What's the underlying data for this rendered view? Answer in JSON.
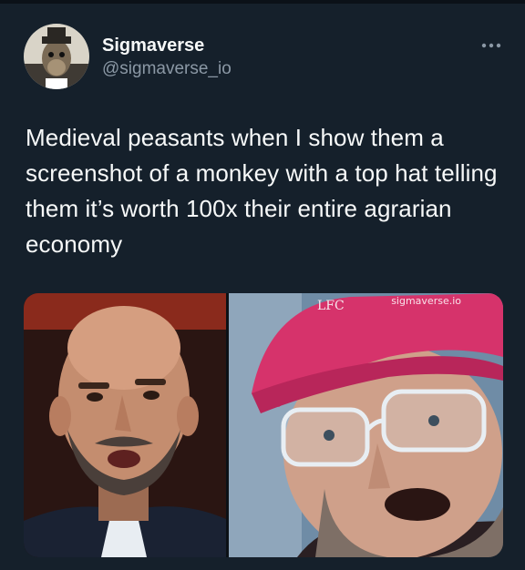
{
  "author": {
    "display_name": "Sigmaverse",
    "handle": "@sigmaverse_io",
    "avatar_icon": "nft-ape-avatar"
  },
  "tweet": {
    "text": "Medieval peasants when I show them a screenshot of a monkey with a top hat telling them it’s worth 100x their entire agrarian economy",
    "more_icon": "more-options-icon"
  },
  "media": {
    "watermark": "sigmaverse.io",
    "cap_logo": "LFC"
  },
  "colors": {
    "background": "#15202b",
    "name_text": "#f7f9f9",
    "handle_text": "#8b98a5",
    "cap_red": "#d6336b"
  }
}
